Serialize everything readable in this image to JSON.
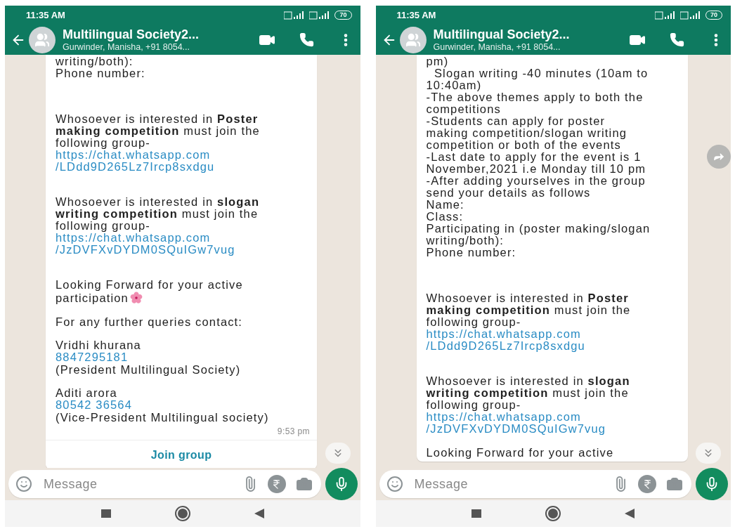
{
  "phones": [
    {
      "status": {
        "time": "11:35 AM",
        "battery": "70"
      },
      "header": {
        "title": "Multilingual Society2...",
        "subtitle": "Gurwinder, Manisha, +91 8054..."
      },
      "message": {
        "blocks": [
          {
            "kind": "text",
            "text": "writing/both):"
          },
          {
            "kind": "text",
            "text": "Phone number:"
          },
          {
            "kind": "blank"
          },
          {
            "kind": "blank"
          },
          {
            "kind": "blank"
          },
          {
            "kind": "rich",
            "text": "Whosoever is interested in **Poster making competition** must join the following group-"
          },
          {
            "kind": "link",
            "text": "https://chat.whatsapp.com\n/LDdd9D265Lz7Ircp8sxdgu"
          },
          {
            "kind": "blank"
          },
          {
            "kind": "blank"
          },
          {
            "kind": "rich",
            "text": "Whosoever is interested in **slogan writing competition** must join the following group-"
          },
          {
            "kind": "link",
            "text": "https://chat.whatsapp.com\n/JzDVFXvDYDM0SQuIGw7vug"
          },
          {
            "kind": "blank"
          },
          {
            "kind": "blank"
          },
          {
            "kind": "text",
            "text": "Looking Forward for your active participation",
            "emoji": true
          },
          {
            "kind": "blank"
          },
          {
            "kind": "text",
            "text": "For any further queries contact:"
          },
          {
            "kind": "blank"
          },
          {
            "kind": "text",
            "text": "Vridhi khurana"
          },
          {
            "kind": "link",
            "text": "8847295181"
          },
          {
            "kind": "text",
            "text": "(President Multilingual Society)"
          },
          {
            "kind": "blank"
          },
          {
            "kind": "text",
            "text": "Aditi arora"
          },
          {
            "kind": "link",
            "text": "80542 36564"
          },
          {
            "kind": "text",
            "text": "(Vice-President Multilingual society)"
          }
        ],
        "time": "9:53 pm",
        "action": "Join group"
      },
      "forward_button": false,
      "composer": {
        "placeholder": "Message"
      }
    },
    {
      "status": {
        "time": "11:35 AM",
        "battery": "70"
      },
      "header": {
        "title": "Multilingual Society2...",
        "subtitle": "Gurwinder, Manisha, +91 8054..."
      },
      "message": {
        "blocks": [
          {
            "kind": "text",
            "text": "pm)"
          },
          {
            "kind": "text",
            "text": "  Slogan writing -40 minutes (10am to 10:40am)"
          },
          {
            "kind": "text",
            "text": "-The above themes apply to both the competitions"
          },
          {
            "kind": "text",
            "text": "-Students can apply for poster\nmaking competition/slogan writing competition or both of the events"
          },
          {
            "kind": "text",
            "text": "-Last date to apply for the event is 1 November,2021 i.e Monday till 10 pm"
          },
          {
            "kind": "text",
            "text": "-After adding yourselves in the group send your details as follows"
          },
          {
            "kind": "text",
            "text": "Name:"
          },
          {
            "kind": "text",
            "text": "Class:"
          },
          {
            "kind": "text",
            "text": "Participating in (poster making/slogan writing/both):"
          },
          {
            "kind": "text",
            "text": "Phone number:"
          },
          {
            "kind": "blank"
          },
          {
            "kind": "blank"
          },
          {
            "kind": "blank"
          },
          {
            "kind": "rich",
            "text": "Whosoever is interested in **Poster making competition** must join the following group-"
          },
          {
            "kind": "link",
            "text": "https://chat.whatsapp.com\n/LDdd9D265Lz7Ircp8sxdgu"
          },
          {
            "kind": "blank"
          },
          {
            "kind": "blank"
          },
          {
            "kind": "rich",
            "text": "Whosoever is interested in **slogan writing competition** must join the following group-"
          },
          {
            "kind": "link",
            "text": "https://chat.whatsapp.com\n/JzDVFXvDYDM0SQuIGw7vug"
          },
          {
            "kind": "blank"
          },
          {
            "kind": "text",
            "text": "Looking Forward for your active"
          }
        ]
      },
      "forward_button": true,
      "composer": {
        "placeholder": "Message"
      }
    }
  ]
}
